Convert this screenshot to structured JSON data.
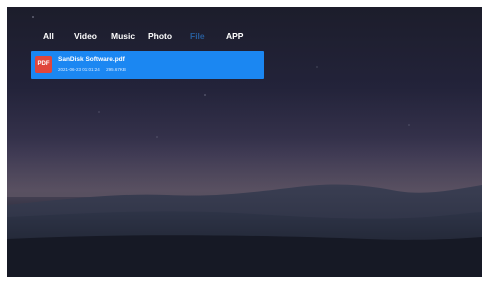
{
  "tabs": [
    {
      "label": "All"
    },
    {
      "label": "Video"
    },
    {
      "label": "Music"
    },
    {
      "label": "Photo"
    },
    {
      "label": "File"
    },
    {
      "label": "APP"
    }
  ],
  "active_tab": "File",
  "files": [
    {
      "icon_label": "PDF",
      "name": "SanDisk Software.pdf",
      "date": "2021-06-23 01:01:24",
      "size": "295.67KB"
    }
  ],
  "colors": {
    "selection": "#1b87f2",
    "pdf_icon": "#e0463c"
  }
}
